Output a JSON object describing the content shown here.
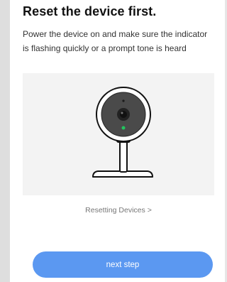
{
  "header": {
    "title": "Reset the device first."
  },
  "instruction": {
    "text": "Power the device on and make sure the indicator is flashing quickly or a prompt tone is heard"
  },
  "illustration": {
    "icon": "security-camera-icon",
    "indicator_color": "#22c55e"
  },
  "help_link": {
    "label": "Resetting Devices >"
  },
  "footer": {
    "next_label": "next step",
    "button_color": "#5b98f1"
  }
}
